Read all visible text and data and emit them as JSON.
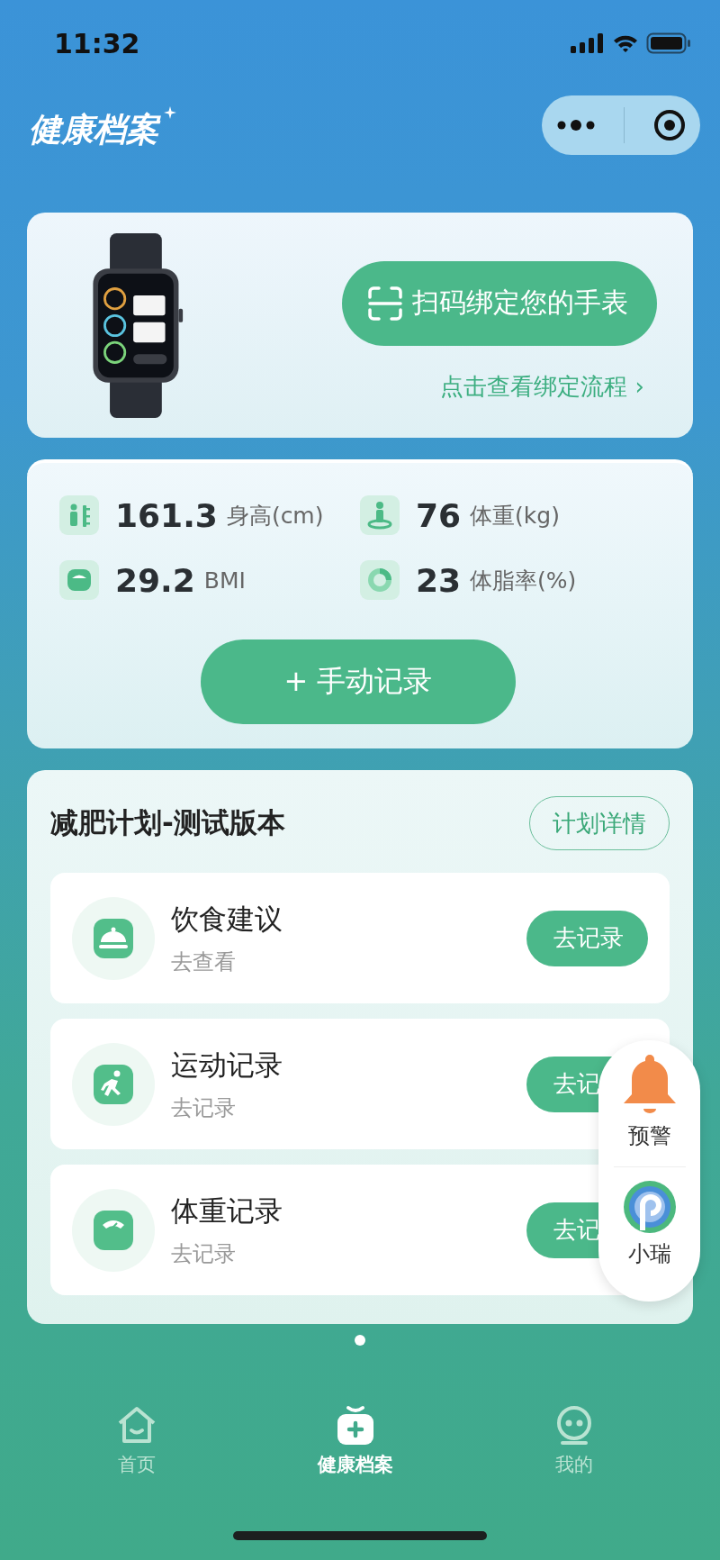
{
  "status_bar": {
    "time": "11:32"
  },
  "header": {
    "title": "健康档案"
  },
  "device_card": {
    "bind_button": "扫码绑定您的手表",
    "link": "点击查看绑定流程",
    "link_arrow": "›"
  },
  "stats": [
    {
      "kind": "height",
      "value": "161.3",
      "unit": "身高(cm)"
    },
    {
      "kind": "weight",
      "value": "76",
      "unit": "体重(kg)"
    },
    {
      "kind": "bmi",
      "value": "29.2",
      "unit": "BMI"
    },
    {
      "kind": "fat",
      "value": "23",
      "unit": "体脂率(%)"
    }
  ],
  "manual_button": "+ 手动记录",
  "plan": {
    "title": "减肥计划-测试版本",
    "details_button": "计划详情",
    "items": [
      {
        "kind": "food",
        "title": "饮食建议",
        "subtitle": "去查看",
        "button": "去记录"
      },
      {
        "kind": "run",
        "title": "运动记录",
        "subtitle": "去记录",
        "button": "去记"
      },
      {
        "kind": "scale",
        "title": "体重记录",
        "subtitle": "去记录",
        "button": "去记"
      }
    ]
  },
  "float_panel": [
    {
      "kind": "bell",
      "label": "预警"
    },
    {
      "kind": "assistant",
      "label": "小瑞"
    }
  ],
  "tabs": [
    {
      "kind": "home",
      "label": "首页",
      "selected": false
    },
    {
      "kind": "record",
      "label": "健康档案",
      "selected": true
    },
    {
      "kind": "me",
      "label": "我的",
      "selected": false
    }
  ]
}
